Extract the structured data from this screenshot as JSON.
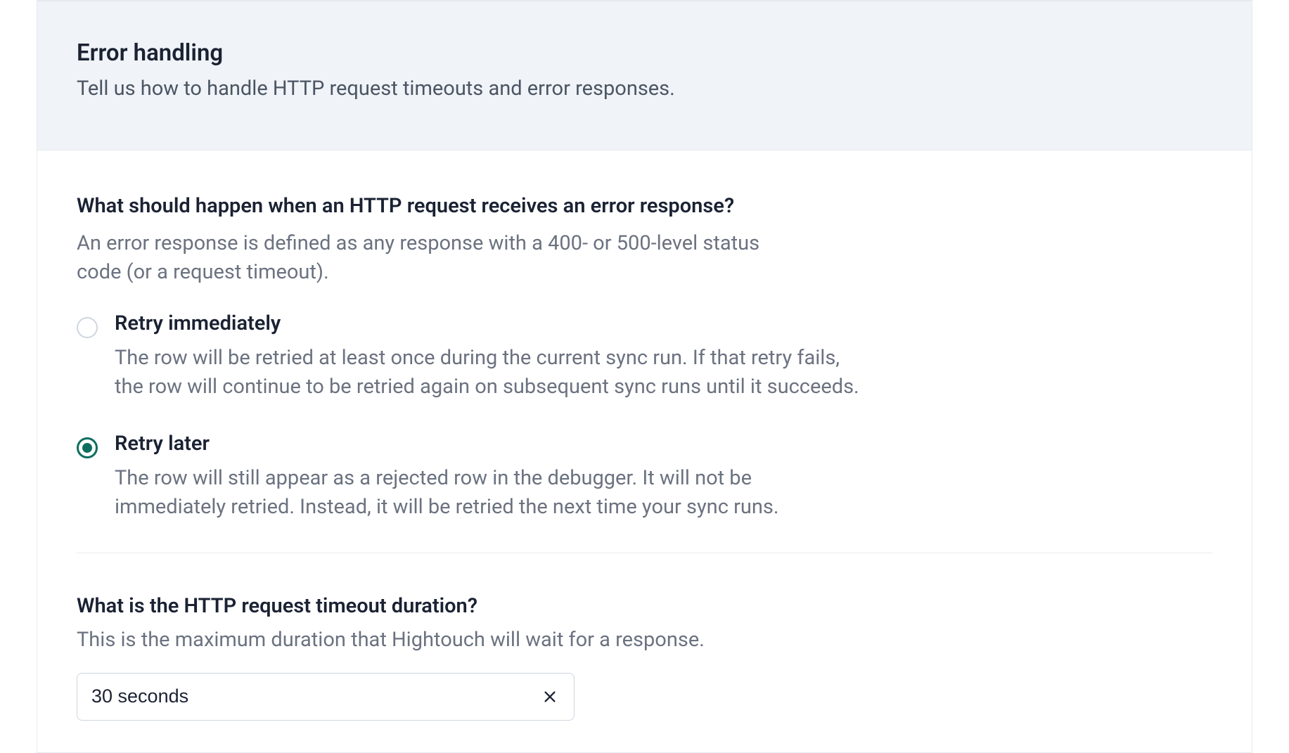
{
  "header": {
    "title": "Error handling",
    "subtitle": "Tell us how to handle HTTP request timeouts and error responses."
  },
  "errorResponse": {
    "question": "What should happen when an HTTP request receives an error response?",
    "description": "An error response is defined as any response with a 400- or 500-level status code (or a request timeout).",
    "options": [
      {
        "id": "retry-immediately",
        "label": "Retry immediately",
        "description": "The row will be retried at least once during the current sync run. If that retry fails, the row will continue to be retried again on subsequent sync runs until it succeeds.",
        "selected": false
      },
      {
        "id": "retry-later",
        "label": "Retry later",
        "description": "The row will still appear as a rejected row in the debugger. It will not be immediately retried. Instead, it will be retried the next time your sync runs.",
        "selected": true
      }
    ]
  },
  "timeout": {
    "question": "What is the HTTP request timeout duration?",
    "description": "This is the maximum duration that Hightouch will wait for a response.",
    "value": "30 seconds"
  }
}
